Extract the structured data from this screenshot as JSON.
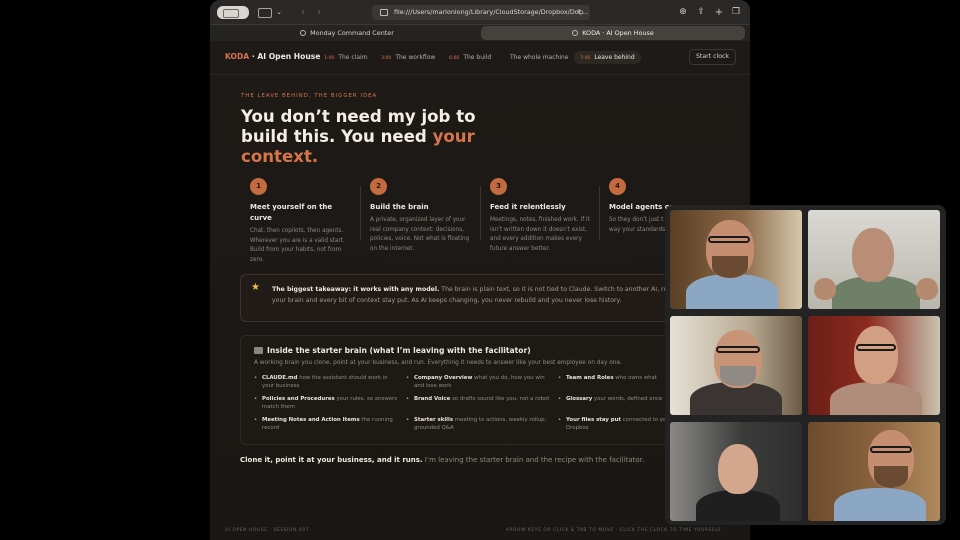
{
  "browser": {
    "url": "file:///Users/marlonlong/Library/CloudStorage/Dropbox/Doc...",
    "tabs": [
      {
        "label": "Monday Command Center"
      },
      {
        "label": "KODA · AI Open House"
      }
    ],
    "icons": [
      "sidebar-icon",
      "chevron-down-icon",
      "back-icon",
      "forward-icon",
      "reload-icon",
      "download-icon",
      "share-icon",
      "new-tab-icon",
      "tab-overview-icon"
    ]
  },
  "page": {
    "brand": {
      "name": "KODA",
      "rest": " · AI Open House"
    },
    "nav": [
      {
        "time": "1:00",
        "label": "The claim"
      },
      {
        "time": "3:00",
        "label": "The workflow"
      },
      {
        "time": "6:00",
        "label": "The build"
      },
      {
        "time": "",
        "label": "The whole machine"
      },
      {
        "time": "7:00",
        "label": "Leave behind"
      }
    ],
    "start_clock": "Start clock",
    "eyebrow": "THE LEAVE BEHIND, THE BIGGER IDEA",
    "headline": {
      "main": "You don’t need my job to build this. You need ",
      "accent": "your context."
    },
    "steps": [
      {
        "num": "1",
        "title": "Meet yourself on the curve",
        "body": "Chat, then copilots, then agents. Wherever you are is a valid start. Build from your habits, not from zero."
      },
      {
        "num": "2",
        "title": "Build the brain",
        "body": "A private, organized layer of your real company context: decisions, policies, voice. Not what is floating on the internet."
      },
      {
        "num": "3",
        "title": "Feed it relentlessly",
        "body": "Meetings, notes, finished work. If it isn’t written down it doesn’t exist, and every addition makes every future answer better."
      },
      {
        "num": "4",
        "title": "Model agents on",
        "body": "So they don’t just t and react the way your standards, for business."
      }
    ],
    "takeaway": {
      "icon": "star-icon",
      "bold": "The biggest takeaway: it works with any model.",
      "text": " The brain is plain text, so it is not tied to Claude. Switch to another AI, run several at once, and your brain and every bit of context stay put. As AI keeps changing, you never rebuild and you never lose history."
    },
    "starter": {
      "icon": "folder-icon",
      "title": "Inside the starter brain (what I’m leaving with the facilitator)",
      "desc": "A working brain you clone, point at your business, and run. Everything it needs to answer like your best employee on day one.",
      "items": [
        {
          "name": "CLAUDE.md",
          "desc": "how the assistant should work in your business"
        },
        {
          "name": "Company Overview",
          "desc": "what you do, how you win and lose work"
        },
        {
          "name": "Team and Roles",
          "desc": "who owns what"
        },
        {
          "name": "Policies and Procedures",
          "desc": "your rules, so answers match them"
        },
        {
          "name": "Brand Voice",
          "desc": "so drafts sound like you, not a robot"
        },
        {
          "name": "Glossary",
          "desc": "your words, defined once"
        },
        {
          "name": "Meeting Notes and Action Items",
          "desc": "the running record"
        },
        {
          "name": "Starter skills",
          "desc": "meeting to actions, weekly rollup, grounded Q&A"
        },
        {
          "name": "Your files stay put",
          "desc": "connected to your Drive or Dropbox"
        }
      ]
    },
    "closing": {
      "bold": "Clone it, point it at your business, and it runs.",
      "text": " I’m leaving the starter brain and the recipe with the facilitator."
    },
    "footer_left": "AI OPEN HOUSE · SESSION 007",
    "footer_right": "ARROW KEYS OR CLICK & TAB TO MOVE · CLICK THE CLOCK TO TIME YOURSELF"
  },
  "call": {
    "tiles": [
      {
        "participant": "participant-1"
      },
      {
        "participant": "participant-2"
      },
      {
        "participant": "participant-3"
      },
      {
        "participant": "participant-4"
      },
      {
        "participant": "participant-5"
      },
      {
        "participant": "participant-6"
      }
    ]
  }
}
